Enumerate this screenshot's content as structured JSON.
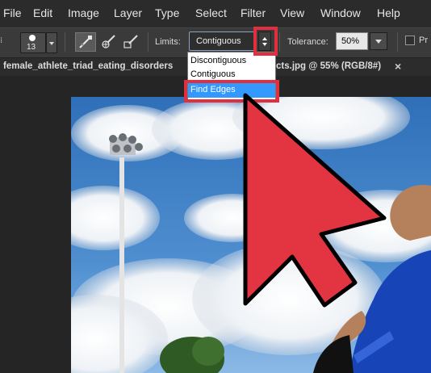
{
  "menu": [
    "File",
    "Edit",
    "Image",
    "Layer",
    "Type",
    "Select",
    "Filter",
    "View",
    "Window",
    "Help"
  ],
  "options_bar": {
    "brush_size": "13",
    "limits_label": "Limits:",
    "limits_value": "Contiguous",
    "tolerance_label": "Tolerance:",
    "tolerance_value": "50%",
    "truncated_label": "Pr"
  },
  "document_tab": {
    "title_left": "female_athlete_triad_eating_disorders",
    "title_right": "cts.jpg @ 55% (RGB/8#)",
    "close": "×"
  },
  "limits_dropdown": {
    "options": [
      "Discontiguous",
      "Contiguous",
      "Find Edges"
    ],
    "selected": "Find Edges"
  },
  "colors": {
    "highlight": "#e03040",
    "arrow_fill": "#e33442",
    "selection_blue": "#3399ff"
  }
}
